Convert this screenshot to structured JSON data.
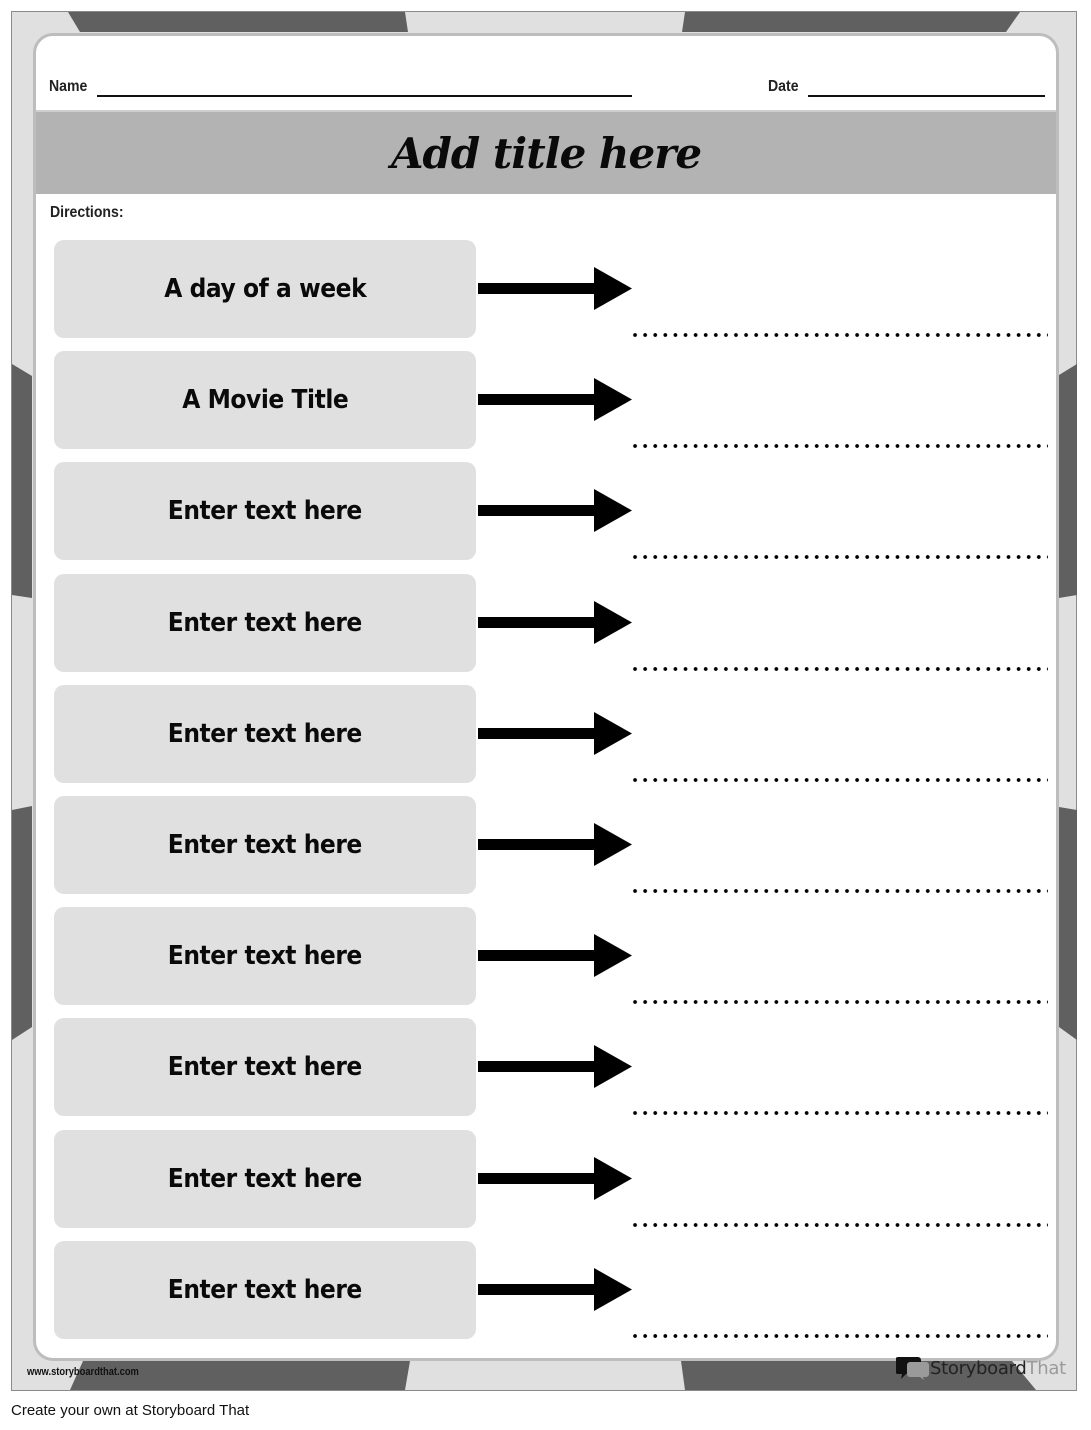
{
  "worksheet": {
    "name_label": "Name",
    "date_label": "Date",
    "title": "Add title here",
    "directions_label": "Directions:",
    "rows": [
      {
        "prompt": "A day of a week",
        "answer": ""
      },
      {
        "prompt": "A Movie Title",
        "answer": ""
      },
      {
        "prompt": "Enter text here",
        "answer": ""
      },
      {
        "prompt": "Enter text here",
        "answer": ""
      },
      {
        "prompt": "Enter text here",
        "answer": ""
      },
      {
        "prompt": "Enter text here",
        "answer": ""
      },
      {
        "prompt": "Enter text here",
        "answer": ""
      },
      {
        "prompt": "Enter text here",
        "answer": ""
      },
      {
        "prompt": "Enter text here",
        "answer": ""
      },
      {
        "prompt": "Enter text here",
        "answer": ""
      }
    ],
    "row_icon": "right-arrow-icon"
  },
  "branding": {
    "website": "www.storyboardthat.com",
    "logo_word1": "Storyboard",
    "logo_word2": "That",
    "logo_icon": "speech-bubbles-icon"
  },
  "footer": {
    "text": "Create your own at Storyboard That"
  },
  "colors": {
    "frame_light": "#e0e0e0",
    "frame_dark": "#606060",
    "title_bar": "#b3b3b3",
    "prompt_box": "#e0e0e0"
  }
}
